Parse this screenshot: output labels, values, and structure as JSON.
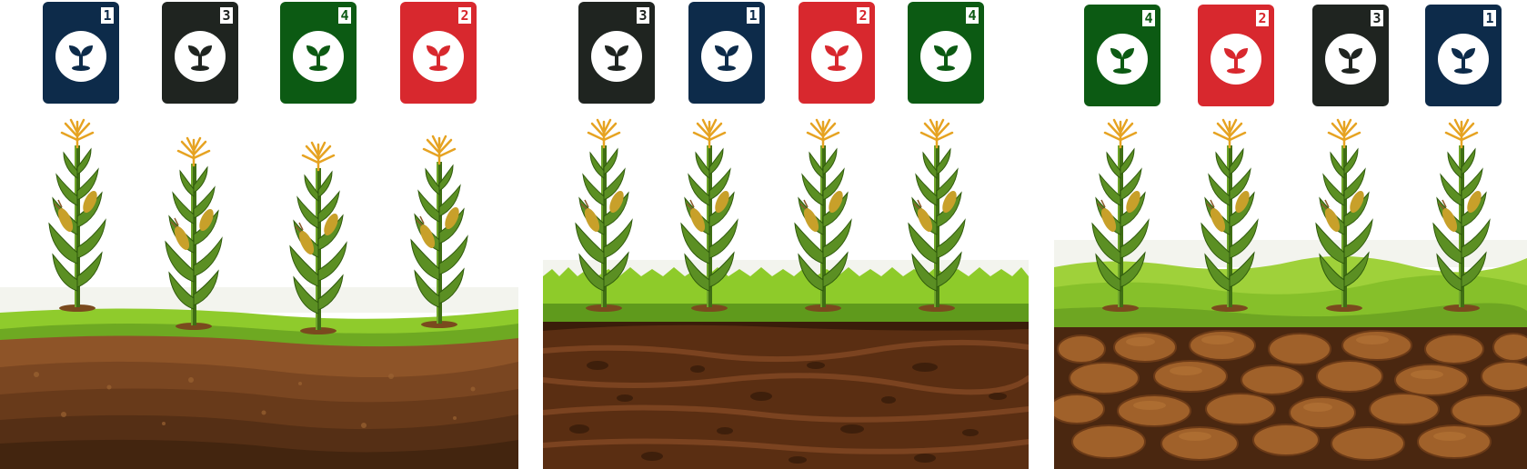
{
  "scene": "Three soil panels, each with four corn plants and four numbered seed bags",
  "colors": {
    "navy": "#0d2b4a",
    "black": "#1f2420",
    "green": "#0c5a13",
    "red": "#d8282e",
    "leaf": "#5b8f23",
    "tassel": "#e6a322"
  },
  "panels": [
    {
      "soil_type": "layered-brown",
      "bags": [
        {
          "number": "1",
          "color": "#0d2b4a"
        },
        {
          "number": "3",
          "color": "#1f2420"
        },
        {
          "number": "4",
          "color": "#0c5a13"
        },
        {
          "number": "2",
          "color": "#d8282e"
        }
      ]
    },
    {
      "soil_type": "dark-clay",
      "bags": [
        {
          "number": "3",
          "color": "#1f2420"
        },
        {
          "number": "1",
          "color": "#0d2b4a"
        },
        {
          "number": "2",
          "color": "#d8282e"
        },
        {
          "number": "4",
          "color": "#0c5a13"
        }
      ]
    },
    {
      "soil_type": "rocky",
      "bags": [
        {
          "number": "4",
          "color": "#0c5a13"
        },
        {
          "number": "2",
          "color": "#d8282e"
        },
        {
          "number": "3",
          "color": "#1f2420"
        },
        {
          "number": "1",
          "color": "#0d2b4a"
        }
      ]
    }
  ]
}
